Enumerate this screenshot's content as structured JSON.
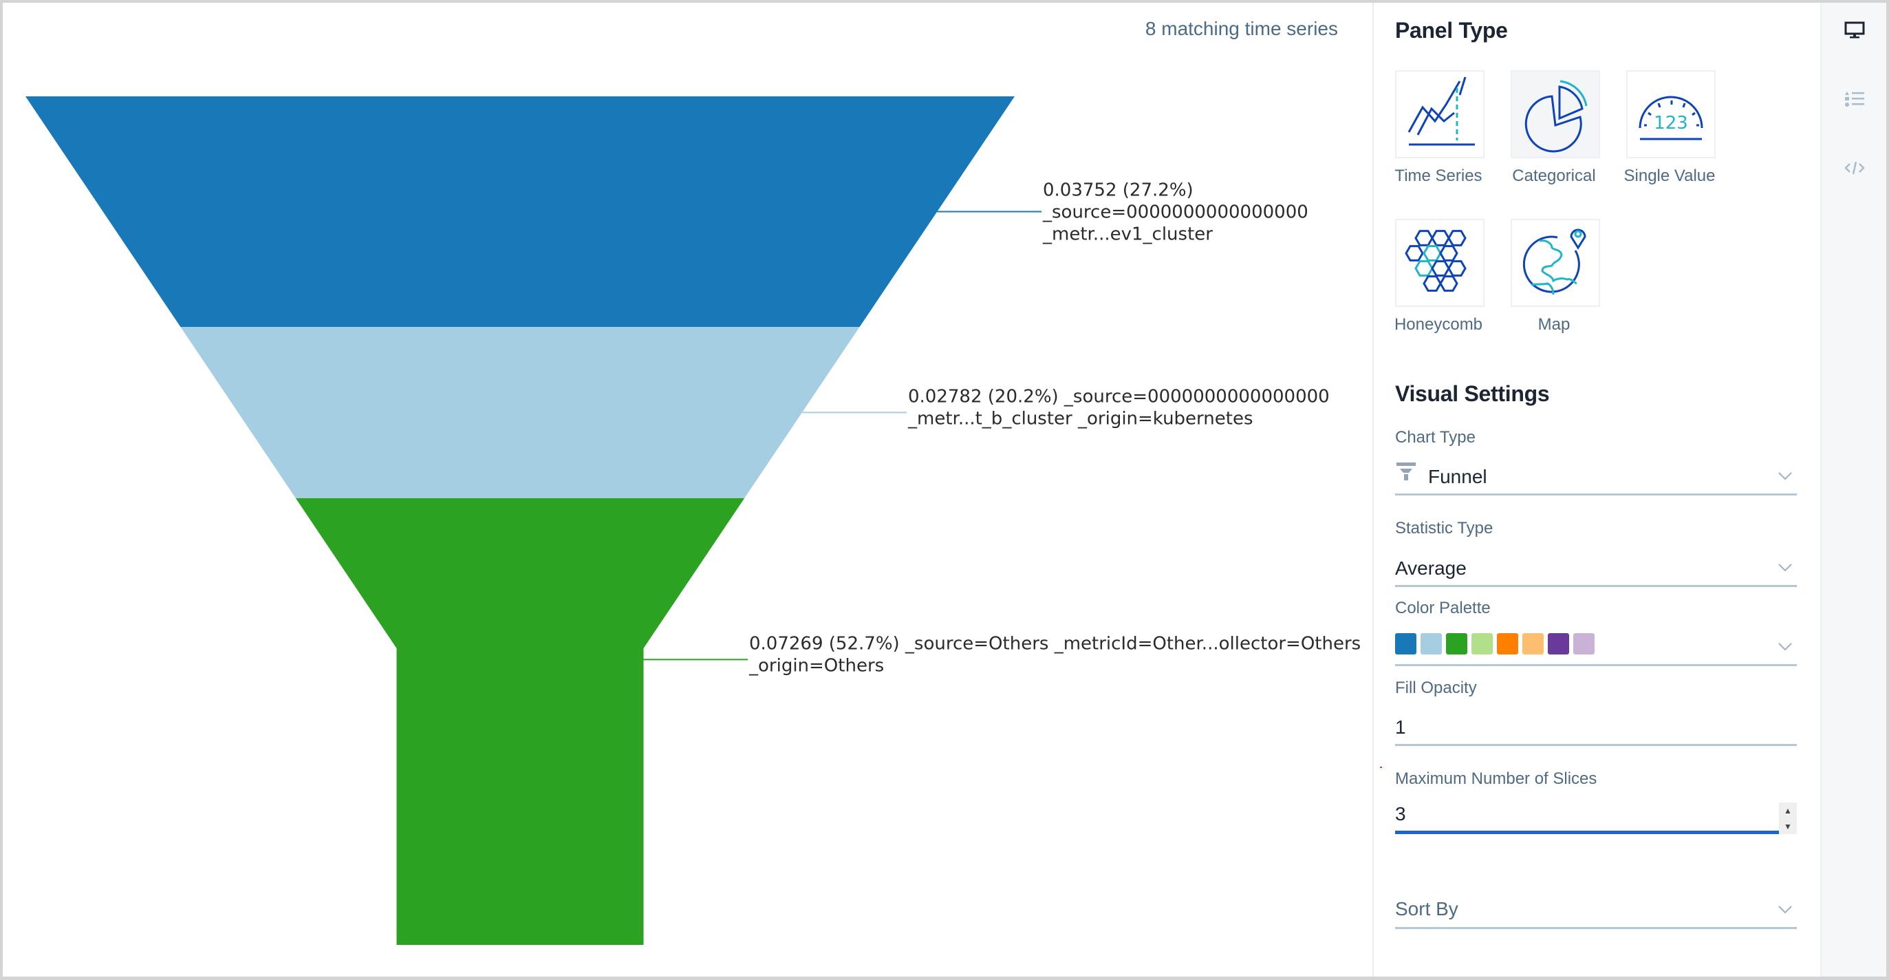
{
  "chart": {
    "match_count": "8 matching time series"
  },
  "chart_data": {
    "type": "funnel",
    "title": "",
    "total_note": "8 matching time series",
    "series": [
      {
        "name": "_source=0000000000000000 _metr...ev1_cluster",
        "value": 0.03752,
        "percent": 27.2,
        "color": "#1878b8",
        "label_lines": [
          "0.03752 (27.2%)",
          "_source=0000000000000000",
          "_metr...ev1_cluster"
        ]
      },
      {
        "name": "_source=0000000000000000 _metr...t_b_cluster _origin=kubernetes",
        "value": 0.02782,
        "percent": 20.2,
        "color": "#a6cee3",
        "label_lines": [
          "0.02782 (20.2%) _source=0000000000000000",
          "_metr...t_b_cluster _origin=kubernetes"
        ]
      },
      {
        "name": "_source=Others _metricId=Other...ollector=Others _origin=Others",
        "value": 0.07269,
        "percent": 52.7,
        "color": "#2ca222",
        "label_lines": [
          "0.07269 (52.7%) _source=Others _metricId=Other...ollector=Others",
          "_origin=Others"
        ]
      }
    ]
  },
  "panel": {
    "panel_type_title": "Panel Type",
    "panel_types": [
      {
        "label": "Time Series",
        "icon": "time-series-icon",
        "selected": false
      },
      {
        "label": "Categorical",
        "icon": "pie-chart-icon",
        "selected": true
      },
      {
        "label": "Single Value",
        "icon": "gauge-icon",
        "selected": false
      },
      {
        "label": "Honeycomb",
        "icon": "honeycomb-icon",
        "selected": false
      },
      {
        "label": "Map",
        "icon": "globe-pin-icon",
        "selected": false
      }
    ],
    "visual_settings_title": "Visual Settings",
    "chart_type": {
      "label": "Chart Type",
      "value": "Funnel",
      "icon": "funnel-icon"
    },
    "statistic_type": {
      "label": "Statistic Type",
      "value": "Average"
    },
    "color_palette": {
      "label": "Color Palette",
      "colors": [
        "#1878b8",
        "#a6cee3",
        "#2ca222",
        "#b2df8a",
        "#ff7f00",
        "#fdbf6f",
        "#6a3a9a",
        "#cab2d6"
      ]
    },
    "fill_opacity": {
      "label": "Fill Opacity",
      "value": "1"
    },
    "max_slices": {
      "label": "Maximum Number of Slices",
      "value": "3"
    },
    "sort_by": {
      "label": "Sort By",
      "value": ""
    }
  },
  "sidebar": {
    "items": [
      {
        "icon": "monitor-icon",
        "active": true
      },
      {
        "icon": "list-icon",
        "active": false
      },
      {
        "icon": "code-icon",
        "active": false
      }
    ]
  }
}
